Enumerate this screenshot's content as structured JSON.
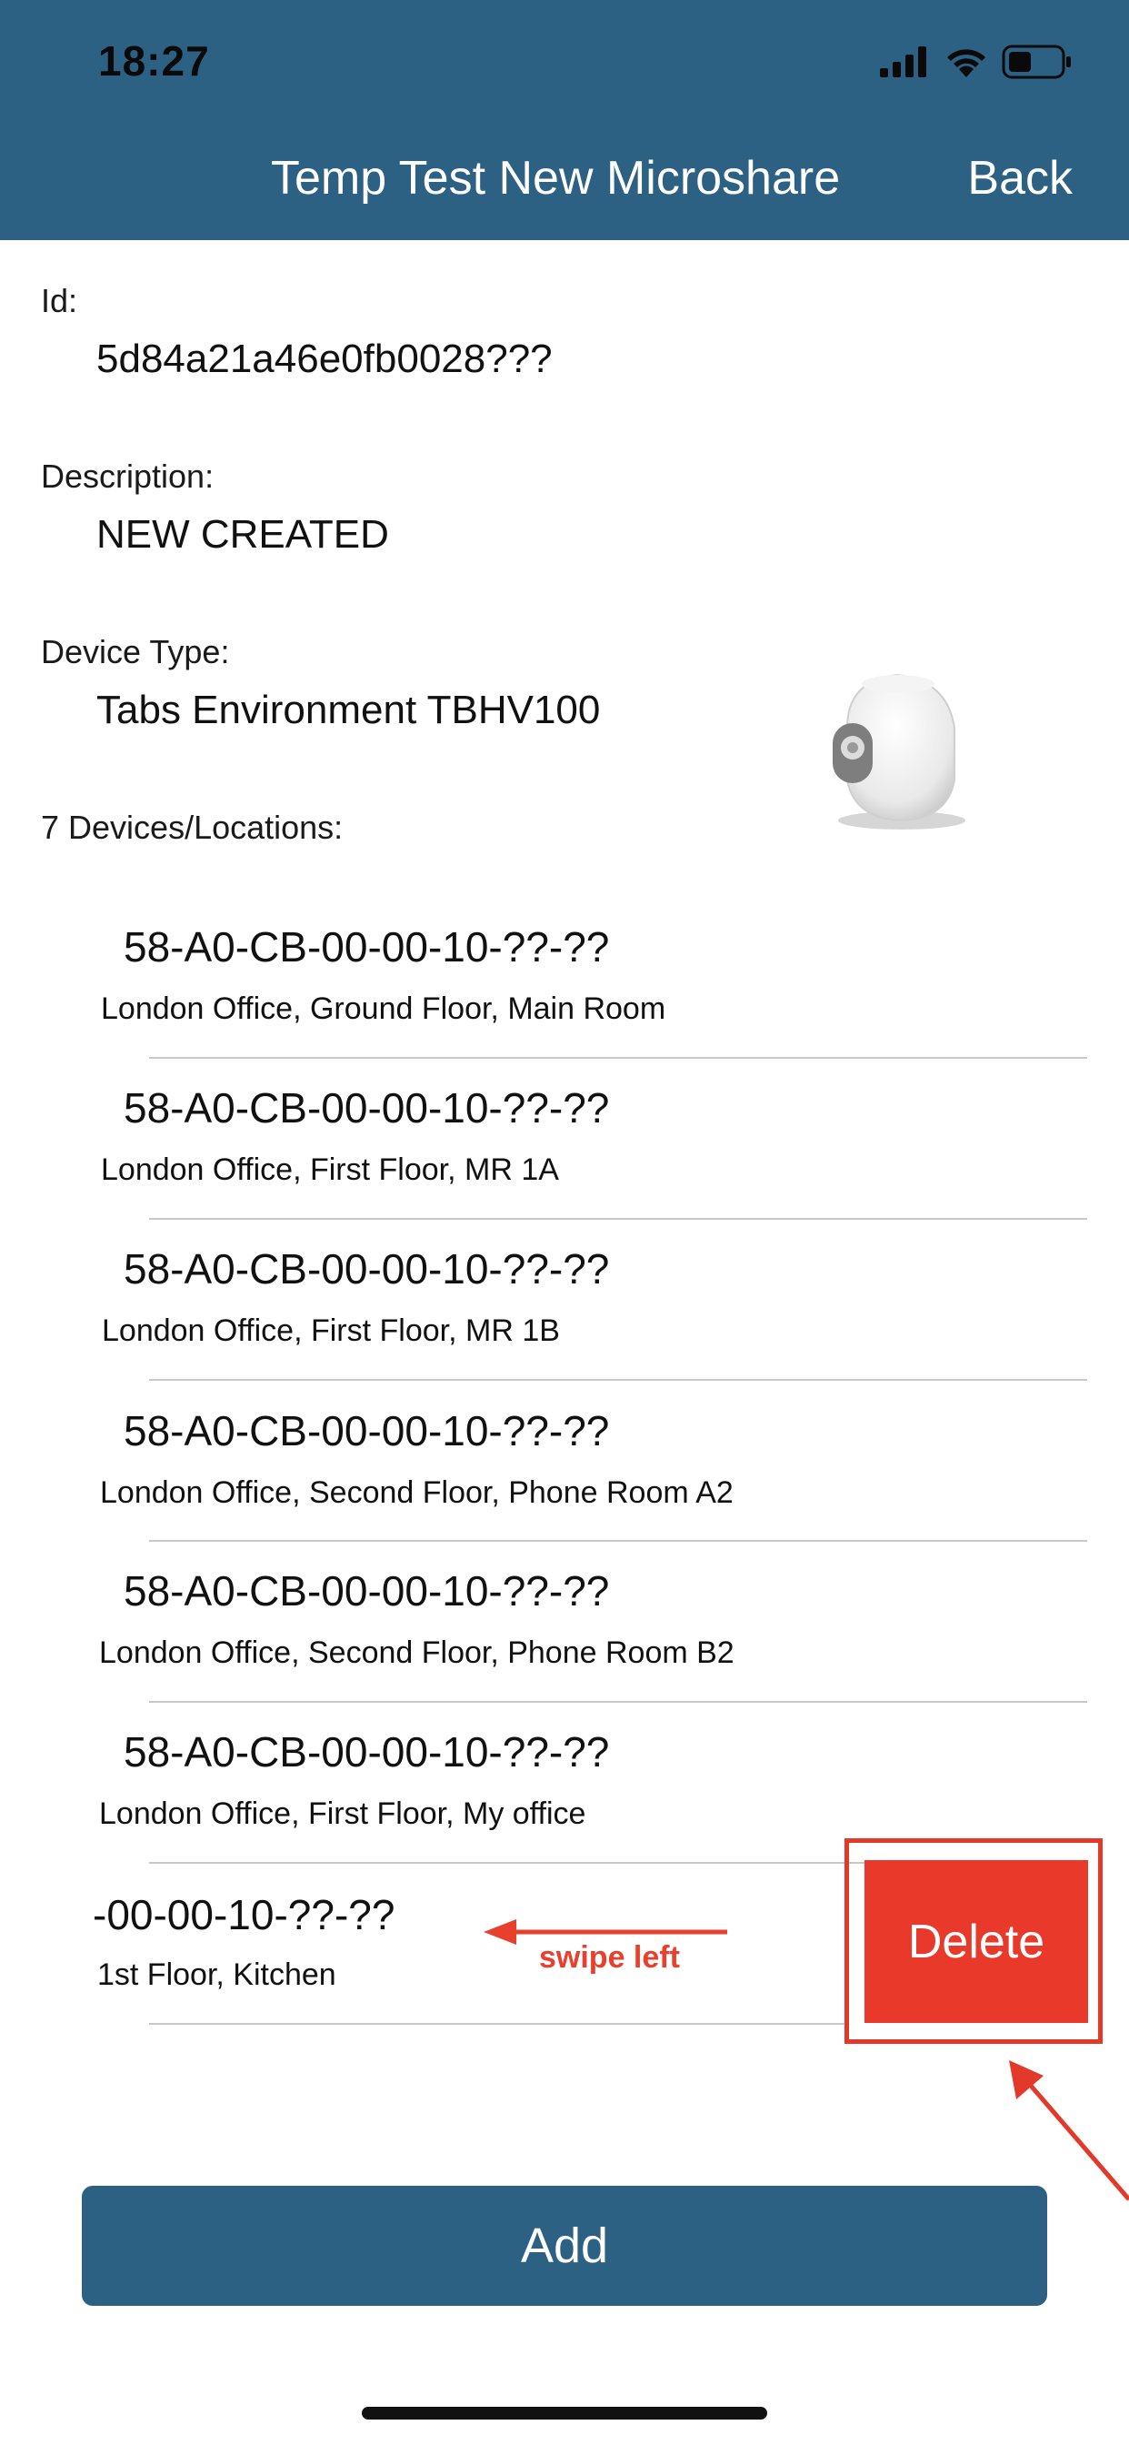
{
  "status_bar": {
    "time": "18:27"
  },
  "nav": {
    "title": "Temp Test New Microshare",
    "back_label": "Back"
  },
  "details": {
    "id_label": "Id:",
    "id_value": "5d84a21a46e0fb0028???",
    "description_label": "Description:",
    "description_value": "NEW CREATED",
    "device_type_label": "Device Type:",
    "device_type_value": "Tabs Environment TBHV100",
    "devices_label": "7 Devices/Locations:"
  },
  "devices": [
    {
      "id": "58-A0-CB-00-00-10-??-??",
      "location": "London Office, Ground Floor, Main Room"
    },
    {
      "id": "58-A0-CB-00-00-10-??-??",
      "location": "London Office, First Floor, MR 1A"
    },
    {
      "id": "58-A0-CB-00-00-10-??-??",
      "location": "London Office, First Floor, MR 1B"
    },
    {
      "id": "58-A0-CB-00-00-10-??-??",
      "location": "London Office, Second Floor, Phone Room A2"
    },
    {
      "id": "58-A0-CB-00-00-10-??-??",
      "location": "London Office, Second Floor, Phone Room B2"
    },
    {
      "id": "58-A0-CB-00-00-10-??-??",
      "location": "London Office, First Floor, My office"
    },
    {
      "id": "-00-00-10-??-??",
      "location": "1st Floor, Kitchen"
    }
  ],
  "swipe_hint": "swipe left",
  "delete_label": "Delete",
  "add_label": "Add",
  "colors": {
    "header": "#2c6183",
    "delete": "#e8392b",
    "annotation": "#e8402c"
  }
}
